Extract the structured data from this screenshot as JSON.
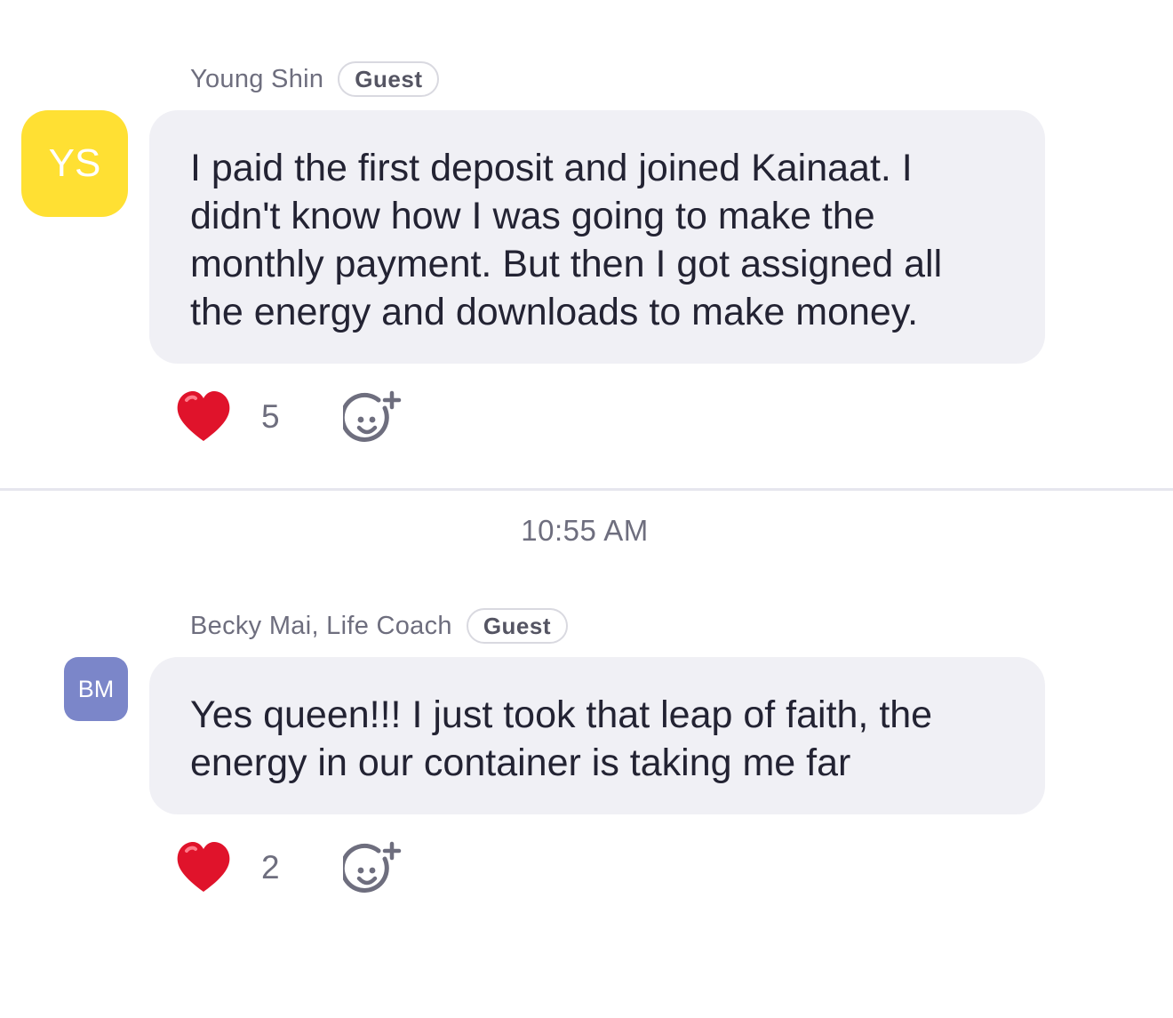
{
  "messages": [
    {
      "sender": "Young Shin",
      "badge": "Guest",
      "avatar_initials": "YS",
      "avatar_color": "#ffe033",
      "text": "I paid the first deposit and joined Kainaat. I\ndidn't know how I was going to make the\nmonthly payment. But then I got assigned all\nthe energy and downloads to make money.",
      "reaction": {
        "icon": "heart-icon",
        "count": "5"
      }
    },
    {
      "sender": "Becky Mai, Life Coach",
      "badge": "Guest",
      "avatar_initials": "BM",
      "avatar_color": "#7b86c9",
      "text": "Yes queen!!! I just took that leap of faith, the\nenergy in our container is taking me far",
      "reaction": {
        "icon": "heart-icon",
        "count": "2"
      }
    }
  ],
  "timestamp": "10:55 AM",
  "colors": {
    "bubble": "#f0f0f5",
    "heart": "#e0132b",
    "secondary_text": "#6e6e7e"
  }
}
